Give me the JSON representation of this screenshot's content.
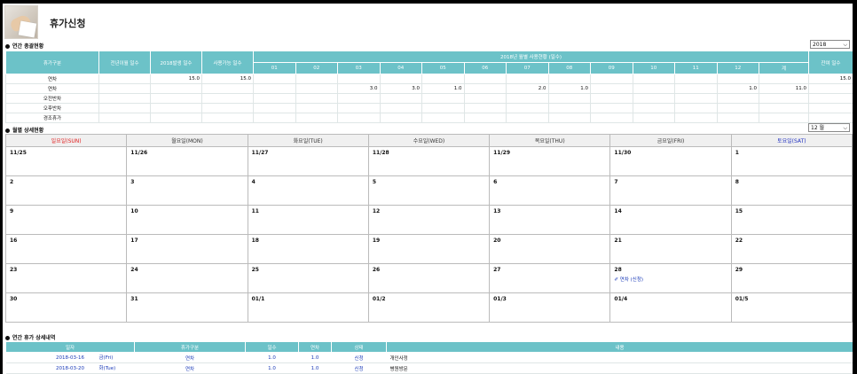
{
  "page": {
    "title": "휴가신청"
  },
  "summary": {
    "section_title": "연간 총괄현황",
    "year_select": "2018",
    "headers": {
      "type": "휴가구분",
      "prev": "전년이월 일수",
      "issued": "2018발생 일수",
      "available": "사용가능 일수",
      "monthly": "2018년 월별 사용현황 (일수)",
      "months": [
        "01",
        "02",
        "03",
        "04",
        "05",
        "06",
        "07",
        "08",
        "09",
        "10",
        "11",
        "12"
      ],
      "total": "계",
      "remaining": "잔여 일수"
    },
    "rows": [
      {
        "label": "연차",
        "prev": "",
        "issued": "15.0",
        "available": "15.0",
        "months": [
          "",
          "",
          "",
          "",
          "",
          "",
          "",
          "",
          "",
          "",
          "",
          ""
        ],
        "total": "",
        "remaining": "15.0"
      },
      {
        "label": "연차",
        "prev": "",
        "issued": "",
        "available": "",
        "months": [
          "",
          "",
          "3.0",
          "3.0",
          "1.0",
          "",
          "2.0",
          "1.0",
          "",
          "",
          "",
          "1.0"
        ],
        "total": "11.0",
        "remaining": ""
      },
      {
        "label": "오전반차",
        "prev": "",
        "issued": "",
        "available": "",
        "months": [
          "",
          "",
          "",
          "",
          "",
          "",
          "",
          "",
          "",
          "",
          "",
          ""
        ],
        "total": "",
        "remaining": ""
      },
      {
        "label": "오후반차",
        "prev": "",
        "issued": "",
        "available": "",
        "months": [
          "",
          "",
          "",
          "",
          "",
          "",
          "",
          "",
          "",
          "",
          "",
          ""
        ],
        "total": "",
        "remaining": ""
      },
      {
        "label": "경조휴가",
        "prev": "",
        "issued": "",
        "available": "",
        "months": [
          "",
          "",
          "",
          "",
          "",
          "",
          "",
          "",
          "",
          "",
          "",
          ""
        ],
        "total": "",
        "remaining": ""
      }
    ]
  },
  "monthly": {
    "section_title": "월별 상세현황",
    "month_select": "12 월",
    "days": [
      "일요일(SUN)",
      "월요일(MON)",
      "화요일(TUE)",
      "수요일(WED)",
      "목요일(THU)",
      "금요일(FRI)",
      "토요일(SAT)"
    ],
    "weeks": [
      [
        "11/25",
        "11/26",
        "11/27",
        "11/28",
        "11/29",
        "11/30",
        "1"
      ],
      [
        "2",
        "3",
        "4",
        "5",
        "6",
        "7",
        "8"
      ],
      [
        "9",
        "10",
        "11",
        "12",
        "13",
        "14",
        "15"
      ],
      [
        "16",
        "17",
        "18",
        "19",
        "20",
        "21",
        "22"
      ],
      [
        "23",
        "24",
        "25",
        "26",
        "27",
        "28",
        "29"
      ],
      [
        "30",
        "31",
        "01/1",
        "01/2",
        "01/3",
        "01/4",
        "01/5"
      ]
    ],
    "event": {
      "text": "연차 (신청)"
    }
  },
  "detail": {
    "section_title": "연간 휴가 상세내역",
    "headers": {
      "date": "일자",
      "type": "휴가구분",
      "days": "일수",
      "annual": "연차",
      "status": "상태",
      "content": "내용"
    },
    "rows": [
      {
        "date": "2018-03-16",
        "weekday": "금(Fri)",
        "type": "연차",
        "days": "1.0",
        "annual": "1.0",
        "status": "신청",
        "content": "개인사정"
      },
      {
        "date": "2018-03-20",
        "weekday": "화(Tue)",
        "type": "연차",
        "days": "1.0",
        "annual": "1.0",
        "status": "신청",
        "content": "병원방문"
      }
    ]
  }
}
